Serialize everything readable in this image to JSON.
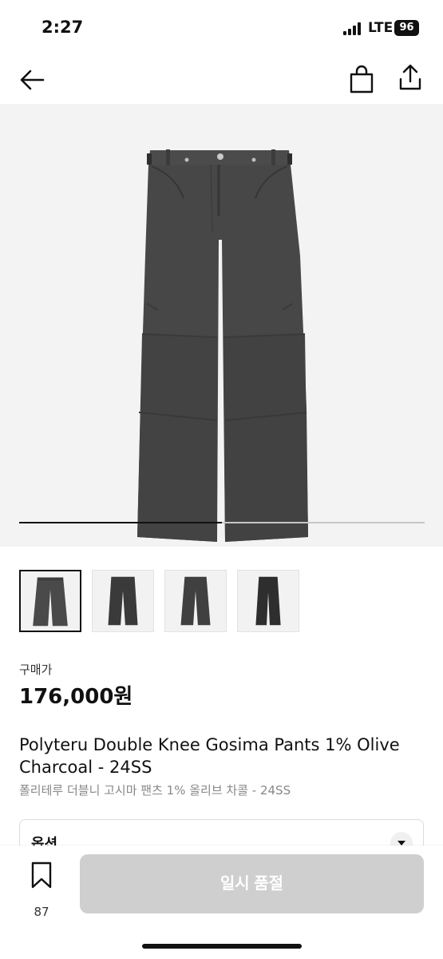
{
  "status_bar": {
    "time": "2:27",
    "network": "LTE",
    "battery": "96"
  },
  "nav": {
    "back_icon": "arrow-left-icon",
    "bag_icon": "shopping-bag-icon",
    "share_icon": "share-icon"
  },
  "gallery": {
    "progress": 0.5,
    "thumbnails": [
      {
        "name": "thumbnail-1",
        "active": true
      },
      {
        "name": "thumbnail-2",
        "active": false
      },
      {
        "name": "thumbnail-3",
        "active": false
      },
      {
        "name": "thumbnail-4",
        "active": false
      }
    ]
  },
  "price": {
    "label": "구매가",
    "value": "176,000원"
  },
  "product": {
    "title": "Polyteru Double Knee Gosima Pants 1% Olive Charcoal - 24SS",
    "subtitle": "폴리테루 더블니 고시마 팬츠 1% 올리브 차콜 - 24SS"
  },
  "options": {
    "label": "옵션"
  },
  "bottom_bar": {
    "bookmark_count": "87",
    "sold_out_label": "일시 품절"
  },
  "colors": {
    "pants": "#4a4a4a",
    "background": "#f3f3f3",
    "button_disabled": "#cfcfcf"
  }
}
